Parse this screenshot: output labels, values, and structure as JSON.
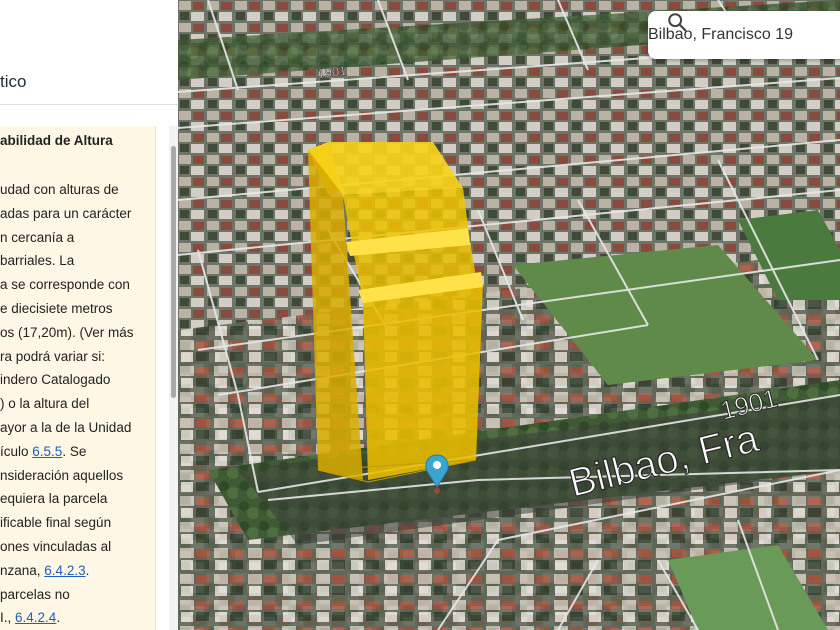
{
  "search": {
    "value": "Bilbao, Francisco 19"
  },
  "panel": {
    "title": "tico",
    "card_heading": "abilidad de Altura",
    "lines": [
      {
        "text": "udad con alturas de"
      },
      {
        "text": "adas para un carácter"
      },
      {
        "text": "n cercanía a"
      },
      {
        "text": "barriales. La"
      },
      {
        "text": "a se corresponde con"
      },
      {
        "text": "e diecisiete metros"
      },
      {
        "text": "os (17,20m). (Ver más"
      },
      {
        "text": "ra podrá variar si:"
      },
      {
        "text": "indero Catalogado"
      },
      {
        "text": ") o la altura del"
      },
      {
        "text": "ayor a la de la Unidad"
      },
      {
        "text": "ículo ",
        "link": "6.5.5",
        "after": ". Se"
      },
      {
        "text": "nsideración aquellos"
      },
      {
        "text": "equiera la parcela"
      },
      {
        "text": "ificable final según"
      },
      {
        "text": "ones vinculadas al"
      },
      {
        "text": "nzana, ",
        "link": "6.4.2.3",
        "after": "."
      },
      {
        "text": "parcelas no"
      },
      {
        "text": "I., ",
        "link": "6.4.2.4",
        "after": "."
      }
    ]
  },
  "map": {
    "street_name": "Bilbao, Fra",
    "street_number": "1901",
    "street_number_top": "1901",
    "colors": {
      "building_yellow": "#f2c200",
      "pin": "#3aa6d0"
    }
  }
}
